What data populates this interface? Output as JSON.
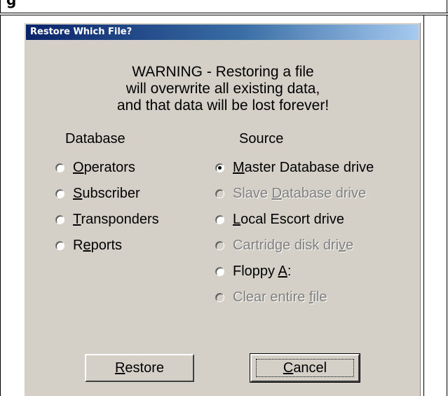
{
  "doc": {
    "top_text": "g"
  },
  "dialog": {
    "title": "Restore Which File?",
    "warning_lines": [
      "WARNING - Restoring a file",
      "will overwrite all existing data,",
      "and that data will be lost forever!"
    ],
    "database_header": "Database",
    "source_header": "Source",
    "database_options": [
      {
        "pre": "",
        "ul": "O",
        "post": "perators",
        "selected": false,
        "enabled": true
      },
      {
        "pre": "",
        "ul": "S",
        "post": "ubscriber",
        "selected": false,
        "enabled": true
      },
      {
        "pre": "",
        "ul": "T",
        "post": "ransponders",
        "selected": false,
        "enabled": true
      },
      {
        "pre": "R",
        "ul": "e",
        "post": "ports",
        "selected": false,
        "enabled": true
      }
    ],
    "source_options": [
      {
        "pre": "",
        "ul": "M",
        "post": "aster Database drive",
        "selected": true,
        "enabled": true
      },
      {
        "pre": "Slave ",
        "ul": "D",
        "post": "atabase drive",
        "selected": false,
        "enabled": false
      },
      {
        "pre": "",
        "ul": "L",
        "post": "ocal Escort drive",
        "selected": false,
        "enabled": true
      },
      {
        "pre": "Cartridge disk dri",
        "ul": "v",
        "post": "e",
        "selected": false,
        "enabled": false
      },
      {
        "pre": "Floppy ",
        "ul": "A",
        "post": ":",
        "selected": false,
        "enabled": true
      },
      {
        "pre": "Clear entire ",
        "ul": "f",
        "post": "ile",
        "selected": false,
        "enabled": false
      }
    ],
    "restore_button": {
      "pre": "",
      "ul": "R",
      "post": "estore"
    },
    "cancel_button": {
      "pre": "",
      "ul": "C",
      "post": "ancel"
    }
  }
}
